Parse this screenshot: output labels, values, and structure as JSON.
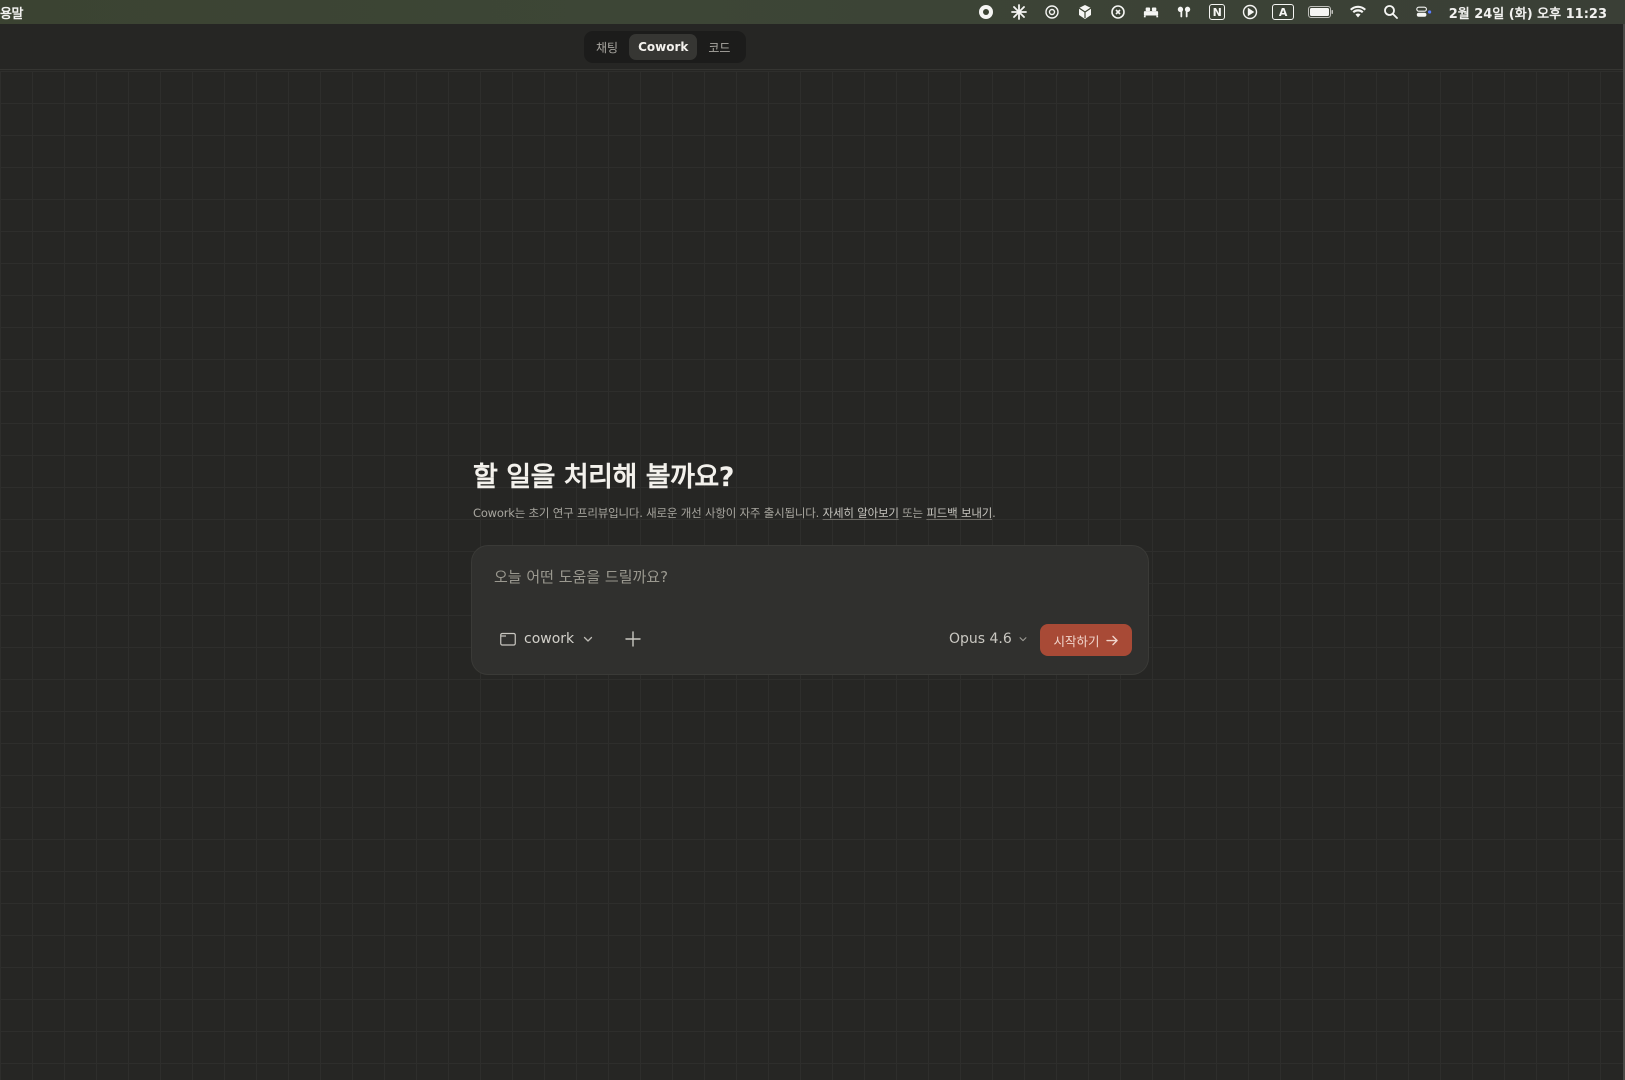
{
  "menubar": {
    "app_name": "용말",
    "clock": "2월 24일 (화) 오후 11:23",
    "tray_icons": [
      "record-icon",
      "sparkle-icon",
      "openai-icon",
      "box-icon",
      "copilot-icon",
      "bed-icon",
      "airpods-icon",
      "notion-icon",
      "play-icon",
      "input-source-icon",
      "battery-icon",
      "wifi-icon",
      "spotlight-icon",
      "control-center-icon"
    ],
    "input_source_label": "A",
    "notion_label": "N"
  },
  "mode_switch": {
    "tabs": [
      {
        "label": "채팅",
        "active": false
      },
      {
        "label": "Cowork",
        "active": true
      },
      {
        "label": "코드",
        "active": false
      }
    ]
  },
  "main": {
    "heading": "할 일을 처리해 볼까요?",
    "subtext_prefix": "Cowork는 초기 연구 프리뷰입니다. 새로운 개선 사항이 자주 출시됩니다. ",
    "learn_more": "자세히 알아보기",
    "subtext_mid": " 또는 ",
    "feedback": "피드백 보내기",
    "subtext_suffix": "."
  },
  "composer": {
    "placeholder": "오늘 어떤 도움을 드릴까요?",
    "folder_label": "cowork",
    "model_label": "Opus 4.6",
    "start_label": "시작하기"
  },
  "colors": {
    "accent": "#a84a36",
    "background": "#262624",
    "composer": "#30302e"
  }
}
